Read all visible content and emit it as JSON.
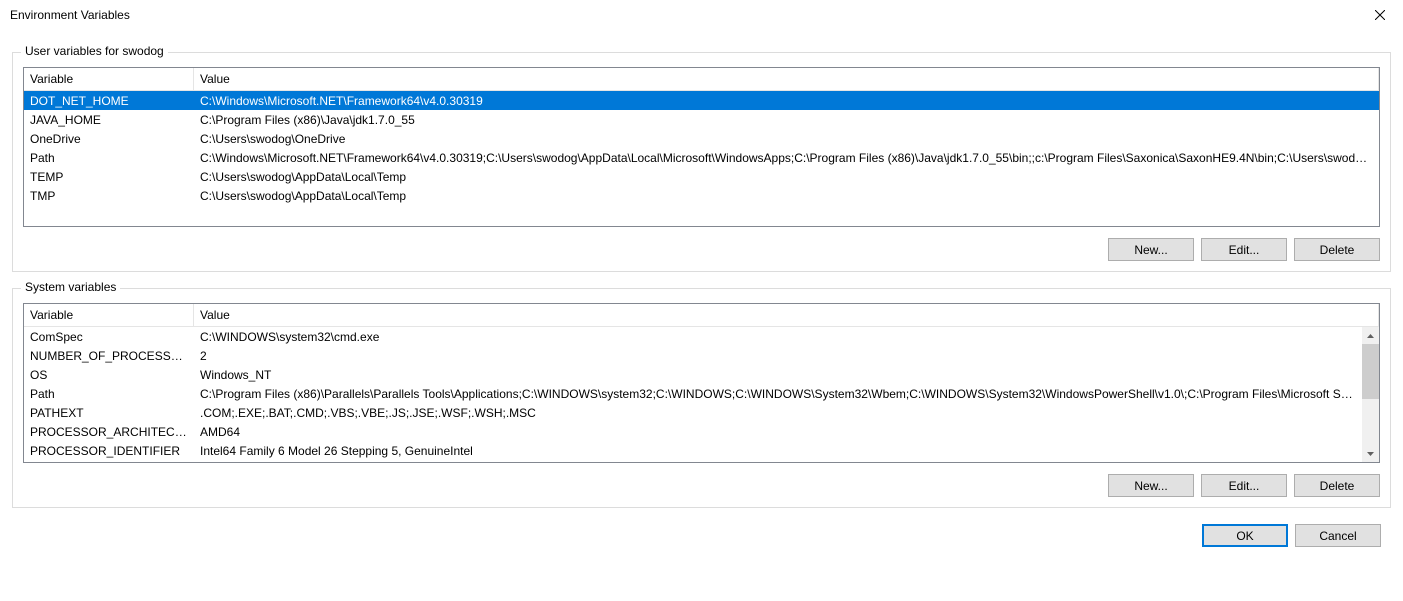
{
  "window_title": "Environment Variables",
  "user_vars": {
    "group_label": "User variables for swodog",
    "col_variable": "Variable",
    "col_value": "Value",
    "rows": [
      {
        "name": "DOT_NET_HOME",
        "value": "C:\\Windows\\Microsoft.NET\\Framework64\\v4.0.30319",
        "selected": true
      },
      {
        "name": "JAVA_HOME",
        "value": "C:\\Program Files (x86)\\Java\\jdk1.7.0_55",
        "selected": false
      },
      {
        "name": "OneDrive",
        "value": "C:\\Users\\swodog\\OneDrive",
        "selected": false
      },
      {
        "name": "Path",
        "value": "C:\\Windows\\Microsoft.NET\\Framework64\\v4.0.30319;C:\\Users\\swodog\\AppData\\Local\\Microsoft\\WindowsApps;C:\\Program Files (x86)\\Java\\jdk1.7.0_55\\bin;;c:\\Program Files\\Saxonica\\SaxonHE9.4N\\bin;C:\\Users\\swodog...",
        "selected": false
      },
      {
        "name": "TEMP",
        "value": "C:\\Users\\swodog\\AppData\\Local\\Temp",
        "selected": false
      },
      {
        "name": "TMP",
        "value": "C:\\Users\\swodog\\AppData\\Local\\Temp",
        "selected": false
      }
    ],
    "buttons": {
      "new": "New...",
      "edit": "Edit...",
      "delete": "Delete"
    }
  },
  "system_vars": {
    "group_label": "System variables",
    "col_variable": "Variable",
    "col_value": "Value",
    "rows": [
      {
        "name": "ComSpec",
        "value": "C:\\WINDOWS\\system32\\cmd.exe"
      },
      {
        "name": "NUMBER_OF_PROCESSORS",
        "value": "2"
      },
      {
        "name": "OS",
        "value": "Windows_NT"
      },
      {
        "name": "Path",
        "value": "C:\\Program Files (x86)\\Parallels\\Parallels Tools\\Applications;C:\\WINDOWS\\system32;C:\\WINDOWS;C:\\WINDOWS\\System32\\Wbem;C:\\WINDOWS\\System32\\WindowsPowerShell\\v1.0\\;C:\\Program Files\\Microsoft SQL S..."
      },
      {
        "name": "PATHEXT",
        "value": ".COM;.EXE;.BAT;.CMD;.VBS;.VBE;.JS;.JSE;.WSF;.WSH;.MSC"
      },
      {
        "name": "PROCESSOR_ARCHITECTURE",
        "value": "AMD64"
      },
      {
        "name": "PROCESSOR_IDENTIFIER",
        "value": "Intel64 Family 6 Model 26 Stepping 5, GenuineIntel"
      }
    ],
    "buttons": {
      "new": "New...",
      "edit": "Edit...",
      "delete": "Delete"
    }
  },
  "dialog_buttons": {
    "ok": "OK",
    "cancel": "Cancel"
  }
}
